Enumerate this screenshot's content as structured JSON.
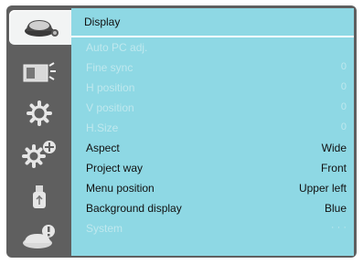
{
  "sidebar": {
    "items": [
      {
        "icon": "display-icon",
        "active": true
      },
      {
        "icon": "picture-icon",
        "active": false
      },
      {
        "icon": "settings-gear-icon",
        "active": false
      },
      {
        "icon": "expanded-settings-icon",
        "active": false
      },
      {
        "icon": "usb-icon",
        "active": false
      },
      {
        "icon": "info-icon",
        "active": false
      }
    ]
  },
  "panel": {
    "title": "Display",
    "rows": [
      {
        "label": "Auto PC adj.",
        "value": "",
        "enabled": false
      },
      {
        "label": "Fine sync",
        "value": "0",
        "enabled": false
      },
      {
        "label": "H position",
        "value": "0",
        "enabled": false
      },
      {
        "label": "V position",
        "value": "0",
        "enabled": false
      },
      {
        "label": "H.Size",
        "value": "0",
        "enabled": false
      },
      {
        "label": "Aspect",
        "value": "Wide",
        "enabled": true
      },
      {
        "label": "Project way",
        "value": "Front",
        "enabled": true
      },
      {
        "label": "Menu position",
        "value": "Upper left",
        "enabled": true
      },
      {
        "label": "Background display",
        "value": "Blue",
        "enabled": true
      },
      {
        "label": "System",
        "value": "· · ·",
        "enabled": false
      }
    ]
  },
  "colors": {
    "frame": "#5f5f5f",
    "panel": "#8ed8e4",
    "disabled_text": "#bfe8ee",
    "enabled_text": "#111111"
  }
}
